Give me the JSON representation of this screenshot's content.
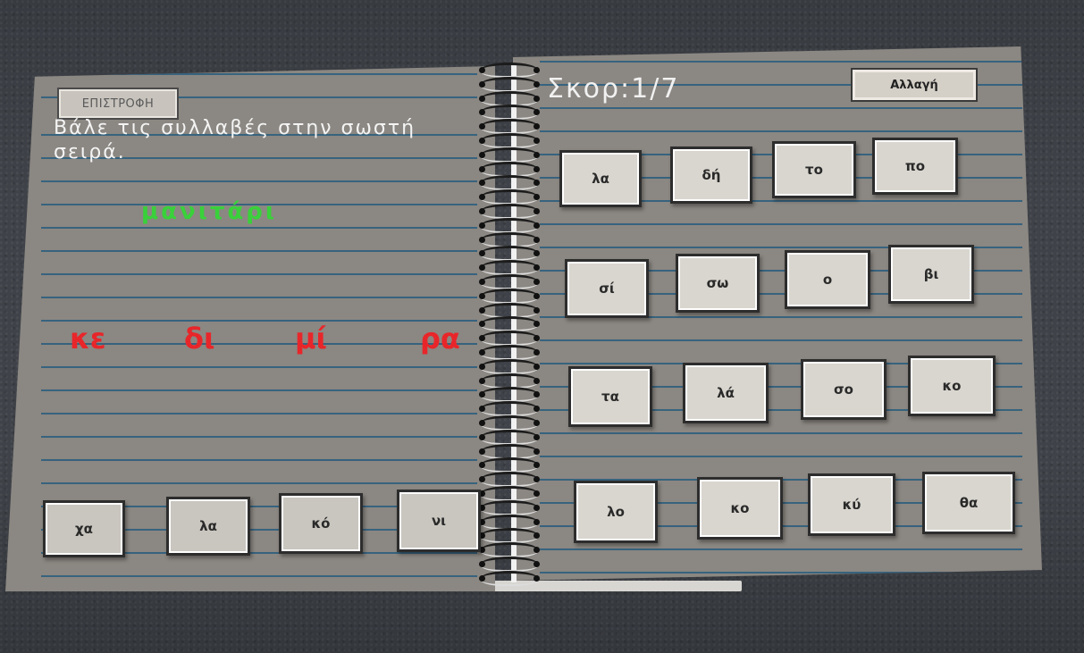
{
  "header": {
    "back_label": "ΕΠΙΣΤΡΟΦΗ",
    "score_label": "Σκορ:1/7",
    "change_label": "Αλλαγή"
  },
  "left_page": {
    "instruction": "Βάλε τις συλλαβές στην σωστή σειρά.",
    "target_word": "μανιτάρι",
    "placed_syllables": [
      "κε",
      "δι",
      "μί",
      "ρα"
    ],
    "slots": [
      "χα",
      "λα",
      "κό",
      "νι"
    ]
  },
  "right_page": {
    "rows": [
      [
        "λα",
        "δή",
        "το",
        "πο"
      ],
      [
        "σί",
        "σω",
        "ο",
        "βι"
      ],
      [
        "τα",
        "λά",
        "σο",
        "κο"
      ],
      [
        "λο",
        "κο",
        "κύ",
        "θα"
      ]
    ]
  },
  "colors": {
    "page": "#8b8782",
    "rule_line": "#2e5f7d",
    "target_word": "#39d13a",
    "placed_text": "#e8262a",
    "tile": "#d9d6cf"
  }
}
